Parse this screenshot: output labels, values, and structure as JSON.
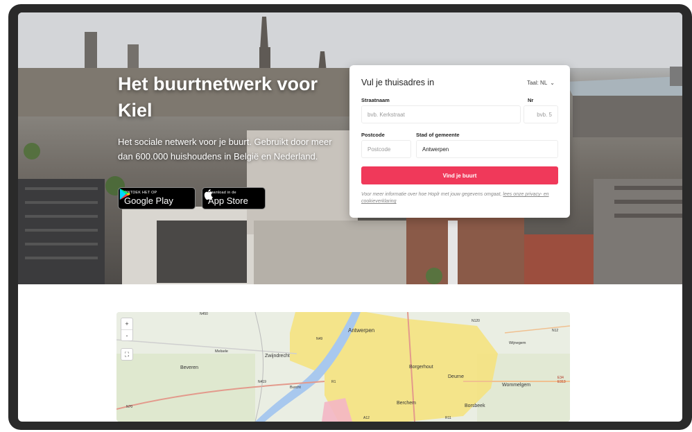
{
  "hero": {
    "title": "Het buurtnetwerk voor Kiel",
    "subtitle": "Het sociale netwerk voor je buurt. Gebruikt door meer dan 600.000 huishoudens in België en Nederland.",
    "google_play": {
      "small": "ONTDEK HET OP",
      "big": "Google Play"
    },
    "app_store": {
      "small": "Download in de",
      "big": "App Store"
    }
  },
  "form": {
    "title": "Vul je thuisadres in",
    "language": "Taal: NL",
    "street_label": "Straatnaam",
    "street_placeholder": "bvb. Kerkstraat",
    "number_label": "Nr",
    "number_placeholder": "bvb. 5",
    "postcode_label": "Postcode",
    "postcode_placeholder": "Postcode",
    "city_label": "Stad of gemeente",
    "city_value": "Antwerpen",
    "submit_label": "Vind je buurt",
    "info_text": "Voor meer informatie over hoe Hoplr met jouw gegevens omgaat,",
    "info_link": "lees onze privacy- en cookieverklaring"
  },
  "map": {
    "zoom_in": "+",
    "zoom_out": "-",
    "fullscreen": "⛶",
    "places": {
      "antwerpen": "Antwerpen",
      "zwijndrecht": "Zwijndrecht",
      "beveren": "Beveren",
      "borgerhout": "Borgerhout",
      "deurne": "Deurne",
      "wommelgem": "Wommelgem",
      "borsbeek": "Borsbeek",
      "berchem": "Berchem",
      "melsele": "Melsele",
      "burcht": "Burcht",
      "wijnegem": "Wijnegem"
    },
    "roads": [
      "N450",
      "N70",
      "N419",
      "E34 E313",
      "N12",
      "N120",
      "R1",
      "A12",
      "N49",
      "R11"
    ]
  }
}
